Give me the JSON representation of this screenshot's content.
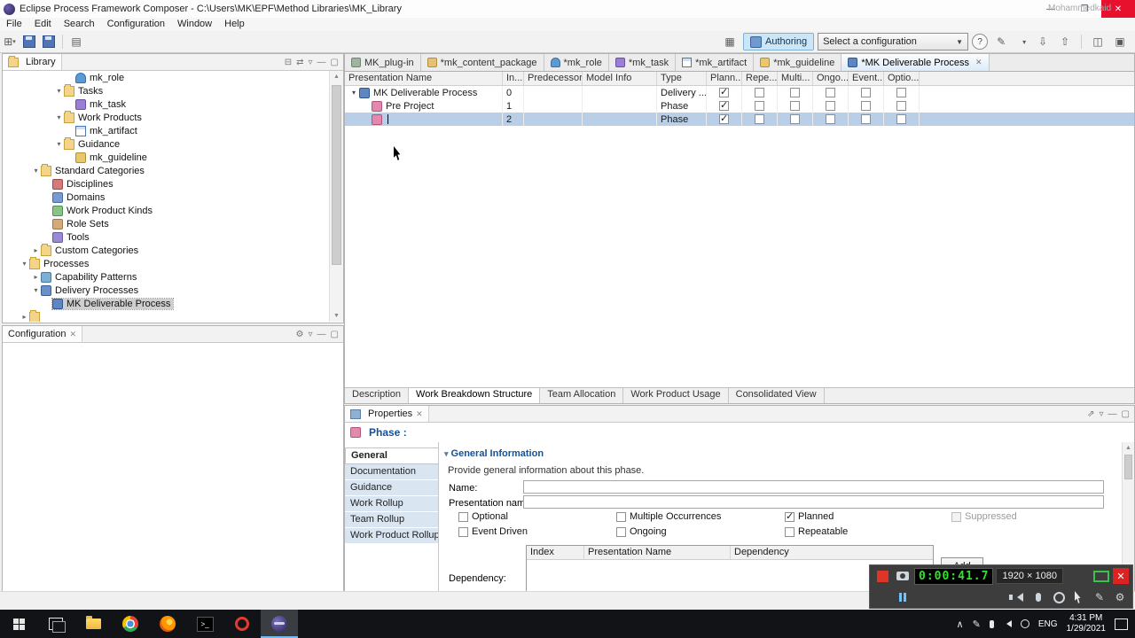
{
  "window": {
    "title": "Eclipse Process Framework Composer - C:\\Users\\MK\\EPF\\Method Libraries\\MK_Library",
    "watermark": "Mohammedkaid",
    "menus": [
      "File",
      "Edit",
      "Search",
      "Configuration",
      "Window",
      "Help"
    ],
    "minimize": "—",
    "restore": "❐",
    "close": "✕"
  },
  "toolbar": {
    "authoring": "Authoring",
    "configuration_combo": "Select a configuration",
    "help": "?"
  },
  "library": {
    "title": "Library",
    "items": [
      {
        "label": "mk_role",
        "icon": "role-icon"
      },
      {
        "label": "Tasks",
        "icon": "folder-icon"
      },
      {
        "label": "mk_task",
        "icon": "task-icon"
      },
      {
        "label": "Work Products",
        "icon": "folder-icon"
      },
      {
        "label": "mk_artifact",
        "icon": "artifact-icon"
      },
      {
        "label": "Guidance",
        "icon": "folder-icon"
      },
      {
        "label": "mk_guideline",
        "icon": "guideline-icon"
      },
      {
        "label": "Standard Categories",
        "icon": "folder-icon"
      },
      {
        "label": "Disciplines",
        "icon": "disciplines-icon"
      },
      {
        "label": "Domains",
        "icon": "domains-icon"
      },
      {
        "label": "Work Product Kinds",
        "icon": "wp-kinds-icon"
      },
      {
        "label": "Role Sets",
        "icon": "role-sets-icon"
      },
      {
        "label": "Tools",
        "icon": "tools-icon"
      },
      {
        "label": "Custom Categories",
        "icon": "folder-icon"
      },
      {
        "label": "Processes",
        "icon": "folder-icon"
      },
      {
        "label": "Capability Patterns",
        "icon": "capability-icon"
      },
      {
        "label": "Delivery Processes",
        "icon": "delivery-icon"
      },
      {
        "label": "MK Deliverable Process",
        "icon": "process-icon"
      }
    ]
  },
  "configuration_view": {
    "title": "Configuration"
  },
  "editor": {
    "tabs": [
      {
        "label": "MK_plug-in",
        "icon": "plugin-icon"
      },
      {
        "label": "*mk_content_package",
        "icon": "package-icon"
      },
      {
        "label": "*mk_role",
        "icon": "role-icon"
      },
      {
        "label": "*mk_task",
        "icon": "task-icon"
      },
      {
        "label": "*mk_artifact",
        "icon": "artifact-icon"
      },
      {
        "label": "*mk_guideline",
        "icon": "guideline-icon"
      },
      {
        "label": "*MK Deliverable Process",
        "icon": "process-icon"
      }
    ],
    "columns": [
      "Presentation Name",
      "In...",
      "Predecessors",
      "Model Info",
      "Type",
      "Plann...",
      "Repe...",
      "Multi...",
      "Ongo...",
      "Event...",
      "Optio..."
    ],
    "rows": [
      {
        "name": "MK Deliverable Process",
        "index": "0",
        "predecessors": "",
        "model_info": "",
        "type": "Delivery ...",
        "planned": true,
        "repeatable": false,
        "multiple_occurrences": false,
        "ongoing": false,
        "event_driven": false,
        "optional": false
      },
      {
        "name": "Pre Project",
        "index": "1",
        "predecessors": "",
        "model_info": "",
        "type": "Phase",
        "planned": true,
        "repeatable": false,
        "multiple_occurrences": false,
        "ongoing": false,
        "event_driven": false,
        "optional": false
      },
      {
        "name": "",
        "index": "2",
        "predecessors": "",
        "model_info": "",
        "type": "Phase",
        "planned": true,
        "repeatable": false,
        "multiple_occurrences": false,
        "ongoing": false,
        "event_driven": false,
        "optional": false
      }
    ],
    "bottom_tabs": [
      "Description",
      "Work Breakdown Structure",
      "Team Allocation",
      "Work Product Usage",
      "Consolidated View"
    ]
  },
  "properties": {
    "tab": "Properties",
    "title": "Phase :",
    "nav": [
      "General",
      "Documentation",
      "Guidance",
      "Work Rollup",
      "Team Rollup",
      "Work Product Rollup"
    ],
    "section": "General Information",
    "description": "Provide general information about this phase.",
    "name_label": "Name:",
    "presentation_name_label": "Presentation name:",
    "checkboxes": {
      "optional": {
        "label": "Optional",
        "checked": false
      },
      "event_driven": {
        "label": "Event Driven",
        "checked": false
      },
      "multiple_occurrences": {
        "label": "Multiple Occurrences",
        "checked": false
      },
      "ongoing": {
        "label": "Ongoing",
        "checked": false
      },
      "planned": {
        "label": "Planned",
        "checked": true
      },
      "repeatable": {
        "label": "Repeatable",
        "checked": false
      },
      "suppressed": {
        "label": "Suppressed",
        "checked": false
      }
    },
    "dependency_label": "Dependency:",
    "dependency_columns": [
      "Index",
      "Presentation Name",
      "Dependency"
    ],
    "add_button": "Add"
  },
  "recorder": {
    "time": "0:00:41.7",
    "resolution": "1920 × 1080"
  },
  "taskbar": {
    "language": "ENG",
    "time": "4:31 PM",
    "date": "1/29/2021"
  }
}
